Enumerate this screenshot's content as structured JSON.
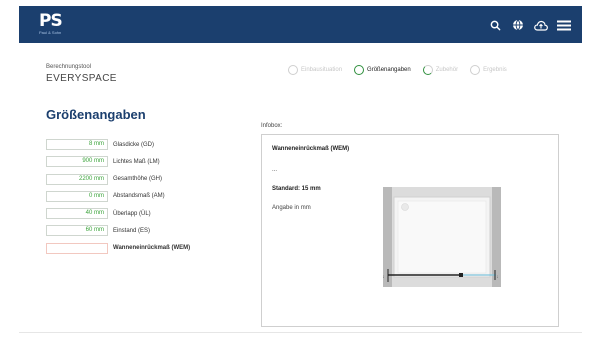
{
  "header": {
    "logo_text": "PS",
    "logo_sub": "Paul & Sohn",
    "icons": [
      "search-icon",
      "globe-icon",
      "cloud-upload-icon",
      "menu-icon"
    ]
  },
  "tool": {
    "label": "Berechnungstool",
    "name": "EVERYSPACE"
  },
  "steps": [
    {
      "label": "Einbausituation",
      "state": "inactive"
    },
    {
      "label": "Größenangaben",
      "state": "active"
    },
    {
      "label": "Zubehör",
      "state": "partial"
    },
    {
      "label": "Ergebnis",
      "state": "inactive"
    }
  ],
  "section_title": "Größenangaben",
  "fields": [
    {
      "value": "8 mm",
      "label": "Glasdicke (GD)"
    },
    {
      "value": "900 mm",
      "label": "Lichtes Maß (LM)"
    },
    {
      "value": "2200 mm",
      "label": "Gesamthöhe (GH)"
    },
    {
      "value": "0 mm",
      "label": "Abstandsmaß (AM)"
    },
    {
      "value": "40 mm",
      "label": "Überlapp (ÜL)"
    },
    {
      "value": "60 mm",
      "label": "Einstand (ES)"
    },
    {
      "value": "",
      "label": "Wanneneinrückmaß (WEM)"
    }
  ],
  "infobox": {
    "title": "Infobox:",
    "heading": "Wanneneinrückmaß (WEM)",
    "dots": "...",
    "standard": "Standard: 15 mm",
    "unit_note": "Angabe in mm"
  },
  "colors": {
    "header_bg": "#1b3f6e",
    "accent_green": "#2f8f3d",
    "value_green": "#3aa33a",
    "title_blue": "#1b3f6e"
  }
}
